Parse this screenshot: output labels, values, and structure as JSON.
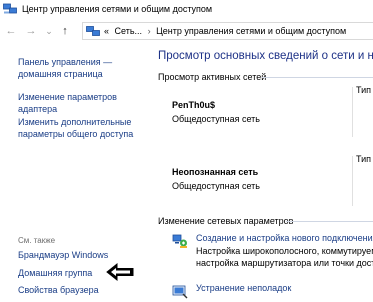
{
  "window": {
    "title": "Центр управления сетями и общим доступом",
    "icon": "network-center-icon"
  },
  "nav": {
    "back_icon": "arrow-left-icon",
    "forward_icon": "arrow-right-icon",
    "recent_icon": "chevron-down-icon",
    "up_icon": "arrow-up-icon",
    "back_glyph": "←",
    "forward_glyph": "→",
    "recent_glyph": "⌄",
    "up_glyph": "↑",
    "breadcrumb": {
      "prefix": "«",
      "item1": "Сеть...",
      "separator": "›",
      "item2": "Центр управления сетями и общим доступом"
    }
  },
  "left_pane": {
    "home_link": "Панель управления — домашняя страница",
    "home_line1": "Панель управления —",
    "home_line2": "домашняя страница",
    "adapter_line1": "Изменение параметров",
    "adapter_line2": "адаптера",
    "sharing_line1": "Изменить дополнительные",
    "sharing_line2": "параметры общего доступа",
    "see_also": "См. также",
    "firewall": "Брандмауэр Windows",
    "homegroup": "Домашняя группа",
    "browser": "Свойства браузера"
  },
  "main": {
    "heading": "Просмотр основных сведений о сети и нас",
    "active_networks_label": "Просмотр активных сетей",
    "networks": [
      {
        "name": "PenTh0u$",
        "type": "Общедоступная сеть",
        "col_label": "Тип"
      },
      {
        "name": "Неопознанная сеть",
        "type": "Общедоступная сеть",
        "col_label": "Тип"
      }
    ],
    "change_settings_label": "Изменение сетевых параметров",
    "tasks": [
      {
        "icon": "network-setup-icon",
        "title": "Создание и настройка нового подключения и",
        "desc1": "Настройка широкополосного, коммутируемого",
        "desc2": "настройка маршрутизатора или точки доступа"
      },
      {
        "icon": "troubleshoot-icon",
        "title": "Устранение неполадок",
        "desc1": "",
        "desc2": ""
      }
    ]
  },
  "annotation": {
    "icon": "black-arrow-left-icon"
  }
}
